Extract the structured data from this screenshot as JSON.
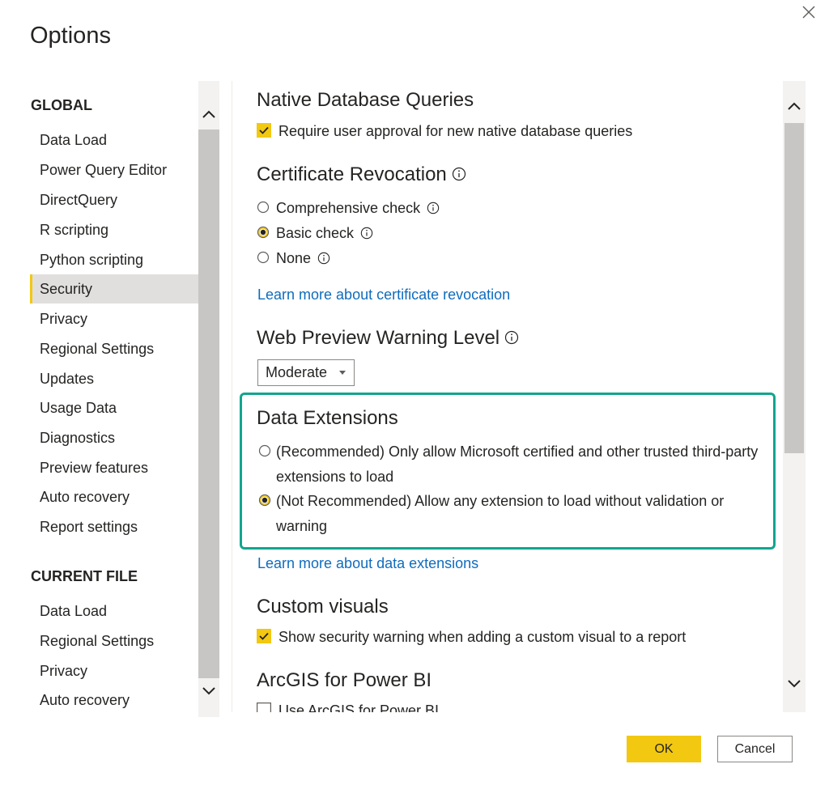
{
  "dialog": {
    "title": "Options",
    "ok_label": "OK",
    "cancel_label": "Cancel"
  },
  "nav": {
    "global_heading": "GLOBAL",
    "global_items": [
      "Data Load",
      "Power Query Editor",
      "DirectQuery",
      "R scripting",
      "Python scripting",
      "Security",
      "Privacy",
      "Regional Settings",
      "Updates",
      "Usage Data",
      "Diagnostics",
      "Preview features",
      "Auto recovery",
      "Report settings"
    ],
    "selected_item": "Security",
    "current_file_heading": "CURRENT FILE",
    "current_file_items": [
      "Data Load",
      "Regional Settings",
      "Privacy",
      "Auto recovery"
    ]
  },
  "content": {
    "native_db": {
      "title": "Native Database Queries",
      "checkbox_label": "Require user approval for new native database queries",
      "checked": true
    },
    "cert_revocation": {
      "title": "Certificate Revocation",
      "options": [
        "Comprehensive check",
        "Basic check",
        "None"
      ],
      "selected": "Basic check",
      "link": "Learn more about certificate revocation"
    },
    "web_preview": {
      "title": "Web Preview Warning Level",
      "dropdown_value": "Moderate"
    },
    "data_extensions": {
      "title": "Data Extensions",
      "option_recommended": "(Recommended) Only allow Microsoft certified and other trusted third-party extensions to load",
      "option_not_recommended": "(Not Recommended) Allow any extension to load without validation or warning",
      "selected": "not_recommended",
      "link": "Learn more about data extensions"
    },
    "custom_visuals": {
      "title": "Custom visuals",
      "checkbox_label": "Show security warning when adding a custom visual to a report",
      "checked": true
    },
    "arcgis": {
      "title": "ArcGIS for Power BI",
      "checkbox_label": "Use ArcGIS for Power BI",
      "checked": false
    }
  },
  "colors": {
    "accent_yellow": "#f2c811",
    "highlight_teal": "#12a58f",
    "link_blue": "#0f6cbd",
    "selected_bg": "#e1dfdd"
  },
  "icons": {
    "close": "close-icon",
    "info": "info-icon",
    "scroll_up": "chevron-up-icon",
    "scroll_down": "chevron-down-icon",
    "dropdown": "caret-down-icon"
  }
}
